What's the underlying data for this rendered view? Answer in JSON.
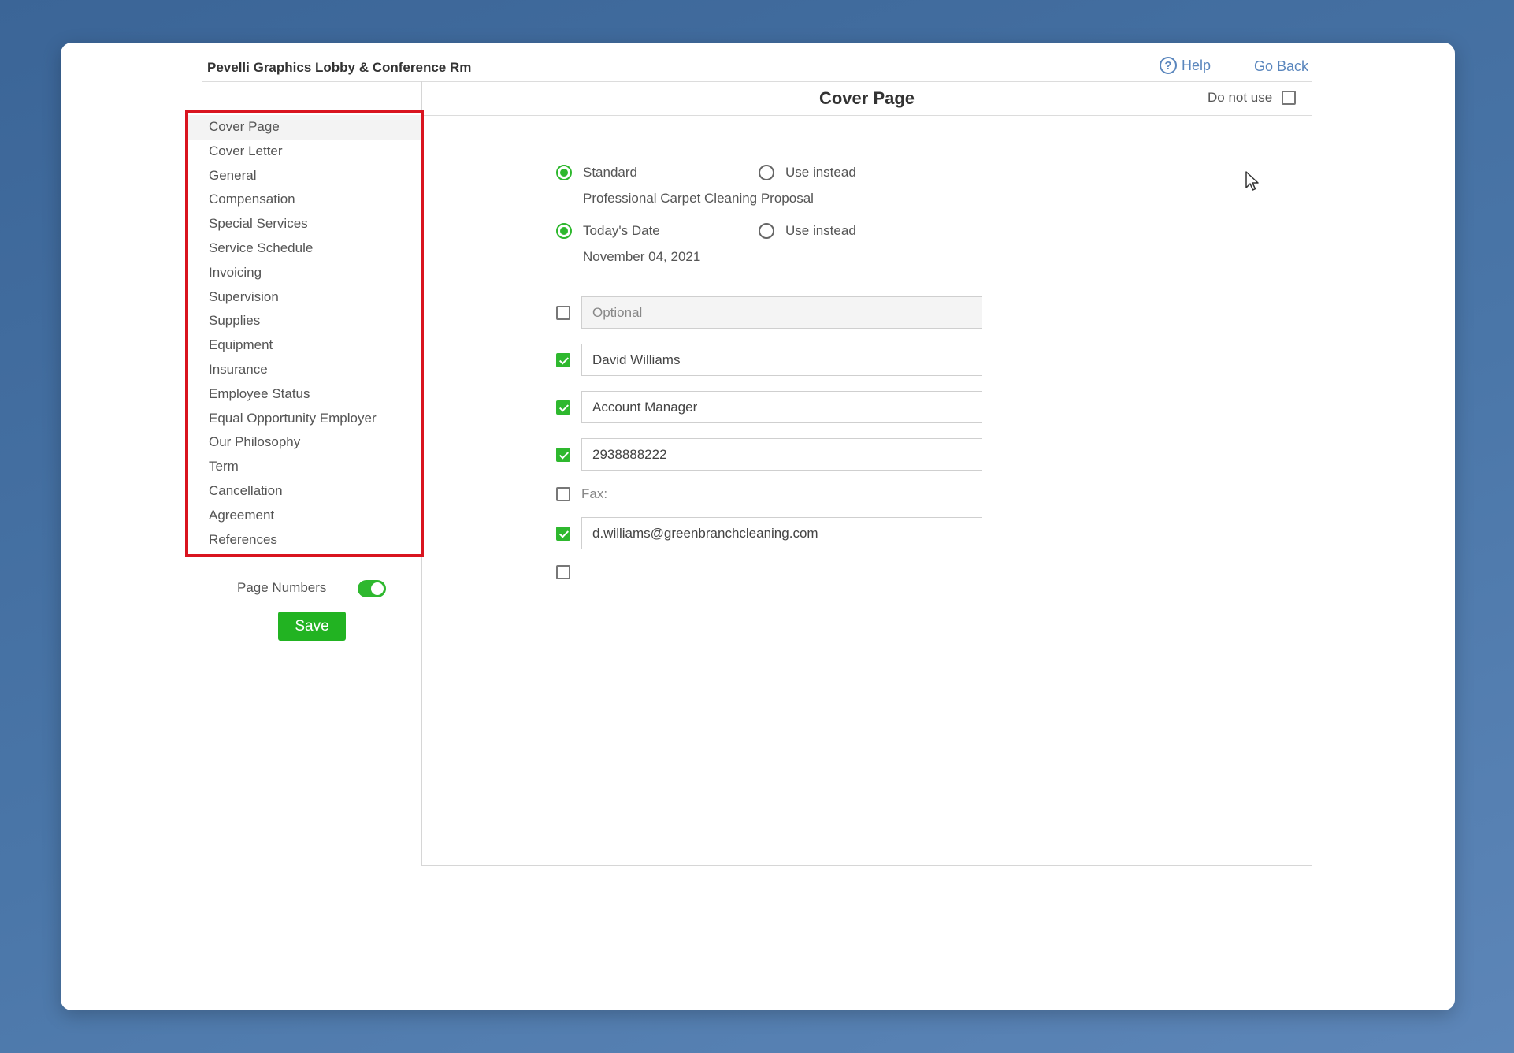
{
  "header": {
    "title": "Pevelli Graphics Lobby & Conference Rm",
    "help_label": "Help",
    "go_back_label": "Go Back"
  },
  "sidebar": {
    "items": [
      {
        "label": "Cover Page",
        "active": true
      },
      {
        "label": "Cover Letter"
      },
      {
        "label": "General"
      },
      {
        "label": "Compensation"
      },
      {
        "label": "Special Services"
      },
      {
        "label": "Service Schedule"
      },
      {
        "label": "Invoicing"
      },
      {
        "label": "Supervision"
      },
      {
        "label": "Supplies"
      },
      {
        "label": "Equipment"
      },
      {
        "label": "Insurance"
      },
      {
        "label": "Employee Status"
      },
      {
        "label": "Equal Opportunity Employer"
      },
      {
        "label": "Our Philosophy"
      },
      {
        "label": "Term"
      },
      {
        "label": "Cancellation"
      },
      {
        "label": "Agreement"
      },
      {
        "label": "References"
      }
    ],
    "page_numbers_label": "Page Numbers",
    "page_numbers_on": true,
    "save_label": "Save"
  },
  "panel": {
    "title": "Cover Page",
    "do_not_use_label": "Do not use",
    "title_options": {
      "standard_label": "Standard",
      "use_instead_label": "Use instead",
      "standard_value": "Professional Carpet Cleaning Proposal"
    },
    "date_options": {
      "todays_date_label": "Today's Date",
      "use_instead_label": "Use instead",
      "date_value": "November 04, 2021"
    },
    "fields": {
      "optional_placeholder": "Optional",
      "name_value": "David Williams",
      "position_value": "Account Manager",
      "phone_value": "2938888222",
      "fax_label": "Fax:",
      "email_value": "d.williams@greenbranchcleaning.com"
    }
  },
  "colors": {
    "accent_green": "#2eb82e",
    "highlight_red": "#d9141f",
    "link_blue": "#5a86bd"
  }
}
